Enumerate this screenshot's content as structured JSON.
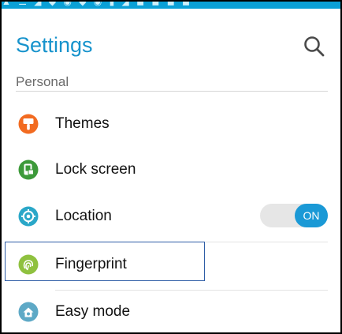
{
  "header": {
    "title": "Settings"
  },
  "section": {
    "label": "Personal"
  },
  "items": [
    {
      "label": "Themes",
      "icon": "themes-icon",
      "color": "#f26b21"
    },
    {
      "label": "Lock screen",
      "icon": "lock-screen-icon",
      "color": "#3d9a3a"
    },
    {
      "label": "Location",
      "icon": "location-icon",
      "color": "#2aa7c8",
      "toggle": "ON"
    },
    {
      "label": "Fingerprint",
      "icon": "fingerprint-icon",
      "color": "#8fc13f"
    },
    {
      "label": "Easy mode",
      "icon": "easy-mode-icon",
      "color": "#5ea9c6"
    }
  ],
  "colors": {
    "accent": "#1793cc",
    "toggle_on": "#1a99d6",
    "highlight_border": "#2e5da6"
  }
}
